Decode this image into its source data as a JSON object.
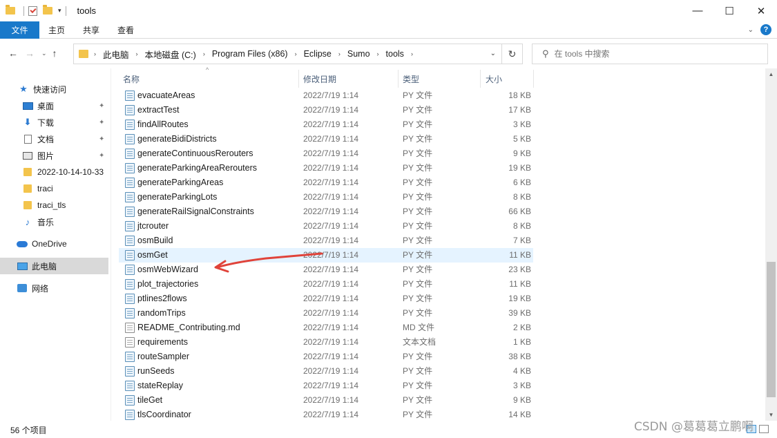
{
  "window": {
    "title": "tools"
  },
  "ribbon": {
    "tabs": [
      "文件",
      "主页",
      "共享",
      "查看"
    ]
  },
  "address": {
    "crumbs": [
      "此电脑",
      "本地磁盘 (C:)",
      "Program Files (x86)",
      "Eclipse",
      "Sumo",
      "tools"
    ]
  },
  "search": {
    "placeholder": "在 tools 中搜索"
  },
  "sidebar": {
    "items": [
      {
        "label": "快速访问",
        "icon": "star-icon"
      },
      {
        "label": "桌面",
        "icon": "desktop-icon",
        "pinned": true
      },
      {
        "label": "下载",
        "icon": "download-icon",
        "pinned": true
      },
      {
        "label": "文档",
        "icon": "documents-icon",
        "pinned": true
      },
      {
        "label": "图片",
        "icon": "pictures-icon",
        "pinned": true
      },
      {
        "label": "2022-10-14-10-33",
        "icon": "folder-icon"
      },
      {
        "label": "traci",
        "icon": "folder-icon"
      },
      {
        "label": "traci_tls",
        "icon": "folder-icon"
      },
      {
        "label": "音乐",
        "icon": "music-icon"
      },
      {
        "label": "OneDrive",
        "icon": "onedrive-icon"
      },
      {
        "label": "此电脑",
        "icon": "this-pc-icon",
        "selected": true
      },
      {
        "label": "网络",
        "icon": "network-icon"
      }
    ]
  },
  "columns": {
    "name": "名称",
    "date": "修改日期",
    "type": "类型",
    "size": "大小"
  },
  "files": [
    {
      "name": "evacuateAreas",
      "date": "2022/7/19 1:14",
      "type": "PY 文件",
      "size": "18 KB"
    },
    {
      "name": "extractTest",
      "date": "2022/7/19 1:14",
      "type": "PY 文件",
      "size": "17 KB"
    },
    {
      "name": "findAllRoutes",
      "date": "2022/7/19 1:14",
      "type": "PY 文件",
      "size": "3 KB"
    },
    {
      "name": "generateBidiDistricts",
      "date": "2022/7/19 1:14",
      "type": "PY 文件",
      "size": "5 KB"
    },
    {
      "name": "generateContinuousRerouters",
      "date": "2022/7/19 1:14",
      "type": "PY 文件",
      "size": "9 KB"
    },
    {
      "name": "generateParkingAreaRerouters",
      "date": "2022/7/19 1:14",
      "type": "PY 文件",
      "size": "19 KB"
    },
    {
      "name": "generateParkingAreas",
      "date": "2022/7/19 1:14",
      "type": "PY 文件",
      "size": "6 KB"
    },
    {
      "name": "generateParkingLots",
      "date": "2022/7/19 1:14",
      "type": "PY 文件",
      "size": "8 KB"
    },
    {
      "name": "generateRailSignalConstraints",
      "date": "2022/7/19 1:14",
      "type": "PY 文件",
      "size": "66 KB"
    },
    {
      "name": "jtcrouter",
      "date": "2022/7/19 1:14",
      "type": "PY 文件",
      "size": "8 KB"
    },
    {
      "name": "osmBuild",
      "date": "2022/7/19 1:14",
      "type": "PY 文件",
      "size": "7 KB"
    },
    {
      "name": "osmGet",
      "date": "2022/7/19 1:14",
      "type": "PY 文件",
      "size": "11 KB",
      "hover": true
    },
    {
      "name": "osmWebWizard",
      "date": "2022/7/19 1:14",
      "type": "PY 文件",
      "size": "23 KB"
    },
    {
      "name": "plot_trajectories",
      "date": "2022/7/19 1:14",
      "type": "PY 文件",
      "size": "11 KB"
    },
    {
      "name": "ptlines2flows",
      "date": "2022/7/19 1:14",
      "type": "PY 文件",
      "size": "19 KB"
    },
    {
      "name": "randomTrips",
      "date": "2022/7/19 1:14",
      "type": "PY 文件",
      "size": "39 KB"
    },
    {
      "name": "README_Contributing.md",
      "date": "2022/7/19 1:14",
      "type": "MD 文件",
      "size": "2 KB",
      "plain": true
    },
    {
      "name": "requirements",
      "date": "2022/7/19 1:14",
      "type": "文本文档",
      "size": "1 KB",
      "plain": true
    },
    {
      "name": "routeSampler",
      "date": "2022/7/19 1:14",
      "type": "PY 文件",
      "size": "38 KB"
    },
    {
      "name": "runSeeds",
      "date": "2022/7/19 1:14",
      "type": "PY 文件",
      "size": "4 KB"
    },
    {
      "name": "stateReplay",
      "date": "2022/7/19 1:14",
      "type": "PY 文件",
      "size": "3 KB"
    },
    {
      "name": "tileGet",
      "date": "2022/7/19 1:14",
      "type": "PY 文件",
      "size": "9 KB"
    },
    {
      "name": "tlsCoordinator",
      "date": "2022/7/19 1:14",
      "type": "PY 文件",
      "size": "14 KB"
    }
  ],
  "status": {
    "count": "56 个项目"
  },
  "watermark": "CSDN @葛葛葛立鹏啊",
  "colors": {
    "accent": "#1979ca",
    "annotation": "#e0433a",
    "hover_row": "#e5f3ff"
  }
}
